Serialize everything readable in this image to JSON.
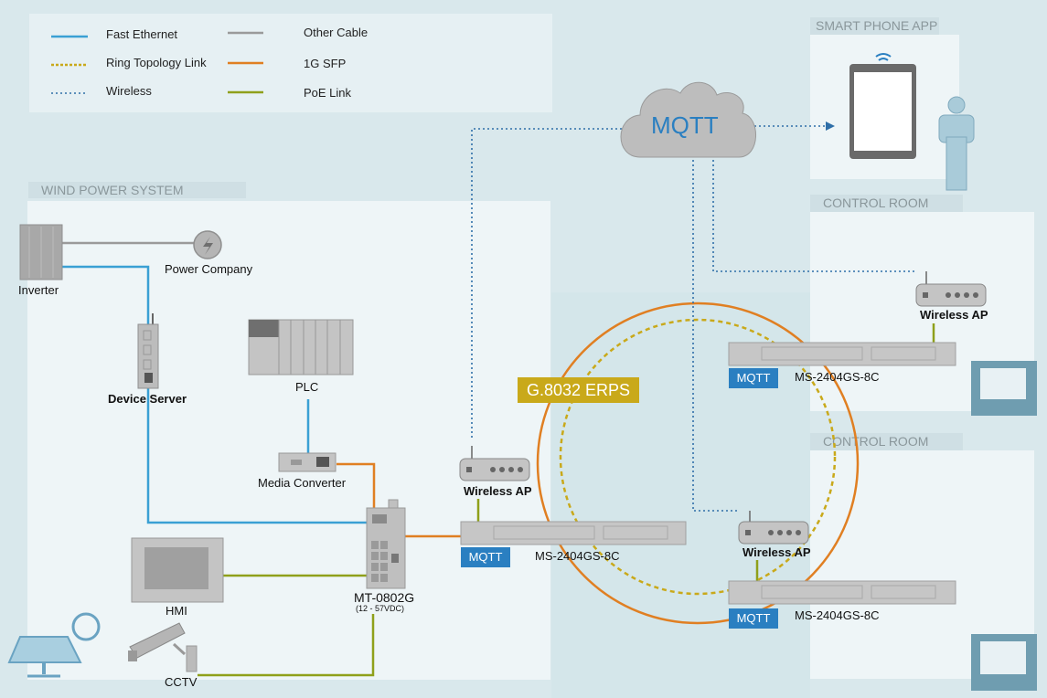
{
  "legend": {
    "items": [
      {
        "label": "Fast Ethernet",
        "style": "solid",
        "color": "#3aa0d4"
      },
      {
        "label": "Ring Topology Link",
        "style": "dashed",
        "color": "#c9a91a"
      },
      {
        "label": "Wireless",
        "style": "dotted",
        "color": "#2f6fa8"
      },
      {
        "label": "Other Cable",
        "style": "solid",
        "color": "#9a9a9a"
      },
      {
        "label": "1G SFP",
        "style": "solid",
        "color": "#e07f22"
      },
      {
        "label": "PoE Link",
        "style": "solid",
        "color": "#8fa01a"
      }
    ]
  },
  "sections": {
    "wind_power": "WIND POWER SYSTEM",
    "smart_phone": "SMART PHONE APP",
    "control_room_1": "CONTROL ROOM",
    "control_room_2": "CONTROL ROOM"
  },
  "devices": {
    "inverter": "Inverter",
    "power_company": "Power Company",
    "device_server": "Device Server",
    "plc": "PLC",
    "media_converter": "Media Converter",
    "hmi": "HMI",
    "cctv": "CCTV",
    "mt_switch": "MT-0802G",
    "mt_switch_power": "(12 - 57VDC)",
    "wireless_ap_1": "Wireless AP",
    "wireless_ap_2": "Wireless AP",
    "wireless_ap_3": "Wireless AP",
    "ms_switch_1": "MS-2404GS-8C",
    "ms_switch_2": "MS-2404GS-8C",
    "ms_switch_3": "MS-2404GS-8C"
  },
  "cloud_label": "MQTT",
  "mqtt_badge": "MQTT",
  "ring_label": "G.8032 ERPS",
  "colors": {
    "fast_ethernet": "#3aa0d4",
    "ring": "#c9a91a",
    "wireless": "#2f6fa8",
    "other": "#9a9a9a",
    "sfp": "#e07f22",
    "poe": "#8fa01a",
    "mqtt_blue": "#2a7fc1",
    "erps_gold": "#c9a91a"
  }
}
